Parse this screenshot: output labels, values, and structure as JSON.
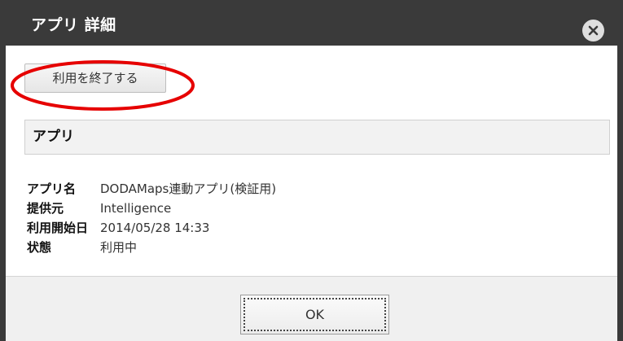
{
  "dialog": {
    "title": "アプリ 詳細",
    "close_icon": "close-icon"
  },
  "actions": {
    "end_use_label": "利用を終了する"
  },
  "section": {
    "header": "アプリ"
  },
  "details": [
    {
      "label": "アプリ名",
      "value": "DODAMaps連動アプリ(検証用)"
    },
    {
      "label": "提供元",
      "value": "Intelligence"
    },
    {
      "label": "利用開始日",
      "value": "2014/05/28 14:33"
    },
    {
      "label": "状態",
      "value": "利用中"
    }
  ],
  "footer": {
    "ok_label": "OK"
  },
  "colors": {
    "titlebar": "#3a3a3a",
    "highlight": "#e60000"
  }
}
